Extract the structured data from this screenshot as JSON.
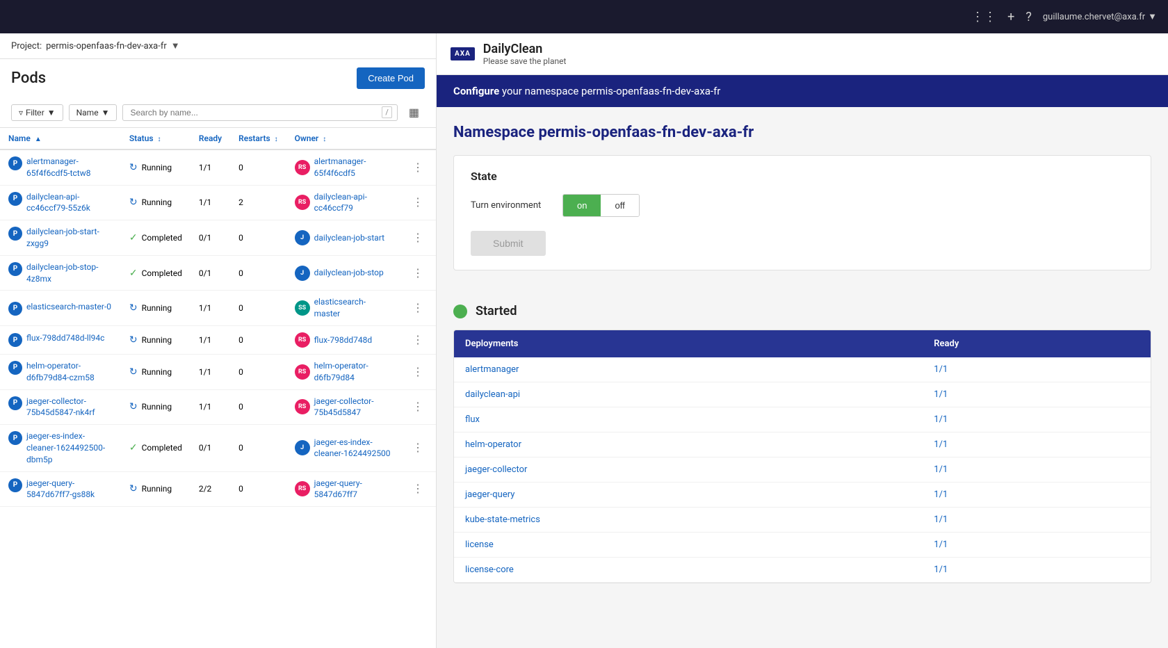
{
  "topNav": {
    "user": "guillaume.chervet@axa.fr",
    "icons": [
      "grid-icon",
      "plus-icon",
      "help-icon"
    ]
  },
  "leftPanel": {
    "project": {
      "label": "Project:",
      "value": "permis-openfaas-fn-dev-axa-fr"
    },
    "title": "Pods",
    "createBtn": "Create Pod",
    "filter": {
      "filterLabel": "Filter",
      "nameLabel": "Name",
      "searchPlaceholder": "Search by name...",
      "searchShortcut": "/"
    },
    "tableHeaders": [
      {
        "label": "Name",
        "sortable": true
      },
      {
        "label": "Status",
        "sortable": true
      },
      {
        "label": "Ready",
        "sortable": false
      },
      {
        "label": "Restarts",
        "sortable": true
      },
      {
        "label": "Owner",
        "sortable": true
      }
    ],
    "pods": [
      {
        "name": "alertmanager-65f4f6cdf5-tctw8",
        "status": "Running",
        "statusType": "running",
        "ready": "1/1",
        "restarts": 0,
        "ownerBadge": "RS",
        "ownerBadgeType": "rs",
        "ownerName": "alertmanager-65f4f6cdf5"
      },
      {
        "name": "dailyclean-api-cc46ccf79-55z6k",
        "status": "Running",
        "statusType": "running",
        "ready": "1/1",
        "restarts": 2,
        "ownerBadge": "RS",
        "ownerBadgeType": "rs",
        "ownerName": "dailyclean-api-cc46ccf79"
      },
      {
        "name": "dailyclean-job-start-zxgg9",
        "status": "Completed",
        "statusType": "completed",
        "ready": "0/1",
        "restarts": 0,
        "ownerBadge": "J",
        "ownerBadgeType": "j",
        "ownerName": "dailyclean-job-start"
      },
      {
        "name": "dailyclean-job-stop-4z8mx",
        "status": "Completed",
        "statusType": "completed",
        "ready": "0/1",
        "restarts": 0,
        "ownerBadge": "J",
        "ownerBadgeType": "j",
        "ownerName": "dailyclean-job-stop"
      },
      {
        "name": "elasticsearch-master-0",
        "status": "Running",
        "statusType": "running",
        "ready": "1/1",
        "restarts": 0,
        "ownerBadge": "SS",
        "ownerBadgeType": "ss",
        "ownerName": "elasticsearch-master"
      },
      {
        "name": "flux-798dd748d-ll94c",
        "status": "Running",
        "statusType": "running",
        "ready": "1/1",
        "restarts": 0,
        "ownerBadge": "RS",
        "ownerBadgeType": "rs",
        "ownerName": "flux-798dd748d"
      },
      {
        "name": "helm-operator-d6fb79d84-czm58",
        "status": "Running",
        "statusType": "running",
        "ready": "1/1",
        "restarts": 0,
        "ownerBadge": "RS",
        "ownerBadgeType": "rs",
        "ownerName": "helm-operator-d6fb79d84"
      },
      {
        "name": "jaeger-collector-75b45d5847-nk4rf",
        "status": "Running",
        "statusType": "running",
        "ready": "1/1",
        "restarts": 0,
        "ownerBadge": "RS",
        "ownerBadgeType": "rs",
        "ownerName": "jaeger-collector-75b45d5847"
      },
      {
        "name": "jaeger-es-index-cleaner-1624492500-dbm5p",
        "status": "Completed",
        "statusType": "completed",
        "ready": "0/1",
        "restarts": 0,
        "ownerBadge": "J",
        "ownerBadgeType": "j",
        "ownerName": "jaeger-es-index-cleaner-1624492500"
      },
      {
        "name": "jaeger-query-5847d67ff7-gs88k",
        "status": "Running",
        "statusType": "running",
        "ready": "2/2",
        "restarts": 0,
        "ownerBadge": "RS",
        "ownerBadgeType": "rs",
        "ownerName": "jaeger-query-5847d67ff7"
      }
    ]
  },
  "rightPanel": {
    "brand": {
      "logoText": "AXA",
      "name": "DailyClean",
      "tagline": "Please save the planet"
    },
    "configureBanner": {
      "prefix": "Configure",
      "suffix": "your namespace permis-openfaas-fn-dev-axa-fr"
    },
    "namespaceTitle": "Namespace permis-openfaas-fn-dev-axa-fr",
    "state": {
      "title": "State",
      "toggleLabel": "Turn environment",
      "onLabel": "on",
      "offLabel": "off",
      "submitLabel": "Submit"
    },
    "started": {
      "title": "Started",
      "tableHeaders": [
        "Deployments",
        "Ready"
      ],
      "deployments": [
        {
          "name": "alertmanager",
          "ready": "1/1"
        },
        {
          "name": "dailyclean-api",
          "ready": "1/1"
        },
        {
          "name": "flux",
          "ready": "1/1"
        },
        {
          "name": "helm-operator",
          "ready": "1/1"
        },
        {
          "name": "jaeger-collector",
          "ready": "1/1"
        },
        {
          "name": "jaeger-query",
          "ready": "1/1"
        },
        {
          "name": "kube-state-metrics",
          "ready": "1/1"
        },
        {
          "name": "license",
          "ready": "1/1"
        },
        {
          "name": "license-core",
          "ready": "1/1"
        }
      ]
    }
  }
}
